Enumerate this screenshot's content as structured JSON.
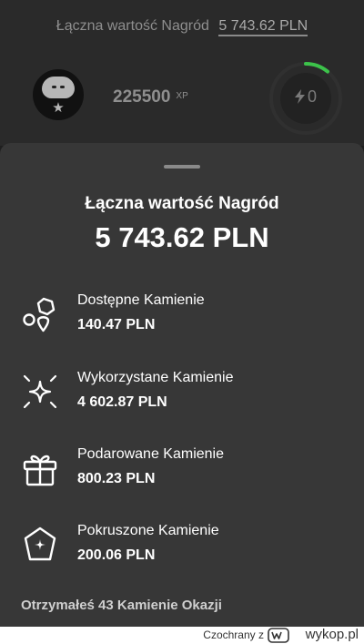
{
  "header": {
    "total_label": "Łączna wartość Nagród",
    "total_value": "5 743.62 PLN",
    "xp_value": "225500",
    "xp_unit": "XP",
    "energy_value": "0"
  },
  "sheet": {
    "title": "Łączna wartość Nagród",
    "total": "5 743.62 PLN",
    "rows": [
      {
        "label": "Dostępne Kamienie",
        "amount": "140.47 PLN",
        "icon": "stones-icon"
      },
      {
        "label": "Wykorzystane Kamienie",
        "amount": "4 602.87 PLN",
        "icon": "sparkle-icon"
      },
      {
        "label": "Podarowane Kamienie",
        "amount": "800.23 PLN",
        "icon": "gift-icon"
      },
      {
        "label": "Pokruszone Kamienie",
        "amount": "200.06 PLN",
        "icon": "crushed-stone-icon"
      }
    ],
    "footer_note": "Otrzymałeś 43 Kamienie Okazji"
  },
  "watermark": {
    "user": "Czochrany  z",
    "site": "wykop.pl"
  },
  "colors": {
    "background": "#1f1f1f",
    "sheet": "#373737",
    "energy_ring": "#3cc24a"
  }
}
